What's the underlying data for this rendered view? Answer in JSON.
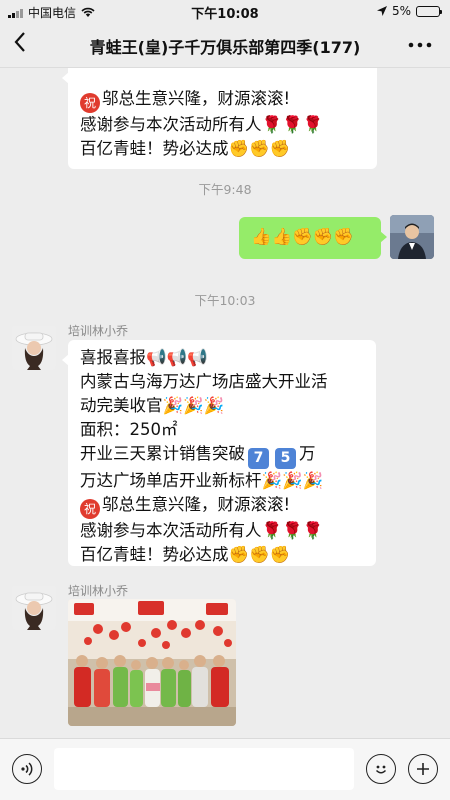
{
  "status_bar": {
    "carrier": "中国电信",
    "time": "下午10:08",
    "battery": "5%",
    "battery_level": 0.05
  },
  "nav": {
    "back_icon": "chevron-left-icon",
    "title": "青蛙王(皇)子千万俱乐部第四季(177)",
    "more_icon": "more-dots-icon"
  },
  "messages": {
    "msg0": {
      "lines": [
        "邬总生意兴隆，财源滚滚!",
        "感谢参与本次活动所有人🌹🌹🌹",
        " 百亿青蛙！势必达成✊✊✊"
      ],
      "seal": "祝"
    },
    "ts1": "下午9:48",
    "msg1": {
      "text": "👍👍✊✊✊"
    },
    "ts2": "下午10:03",
    "msg2": {
      "sender": "培训林小乔",
      "lines": [
        "喜报喜报📢📢📢",
        "内蒙古乌海万达广场店盛大开业活",
        "动完美收官🎉🎉🎉",
        "面积：250㎡",
        "开业三天累计销售突破",
        "万",
        "万达广场单店开业新标杆🎉🎉🎉",
        "邬总生意兴隆，财源滚滚!",
        "感谢参与本次活动所有人🌹🌹🌹",
        " 百亿青蛙！势必达成✊✊✊"
      ],
      "digit1": "7",
      "digit2": "5",
      "seal": "祝"
    },
    "msg3": {
      "sender": "培训林小乔"
    }
  },
  "input_bar": {
    "voice_icon": "voice-icon",
    "emoji_icon": "emoji-icon",
    "plus_icon": "plus-icon",
    "placeholder": ""
  }
}
